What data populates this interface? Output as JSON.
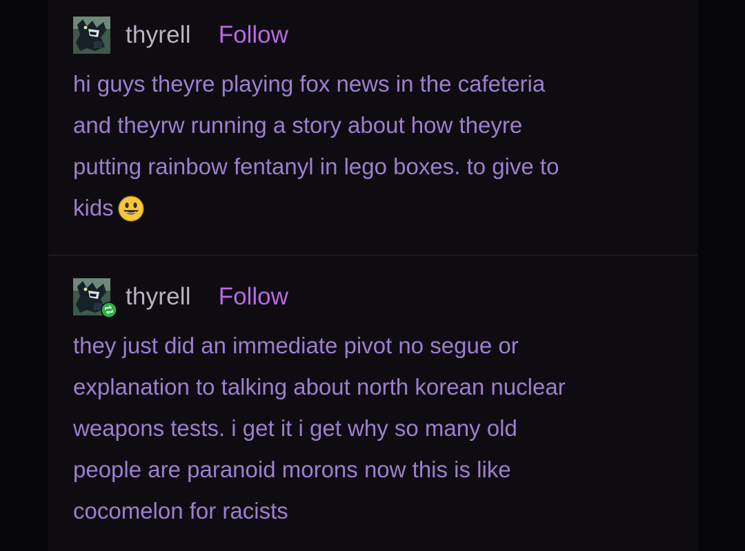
{
  "posts": [
    {
      "username": "thyrell",
      "follow_label": "Follow",
      "lines": [
        "hi guys theyre playing fox news in the cafeteria",
        "and theyrw running a story about how theyre",
        "putting rainbow fentanyl in lego boxes. to give to",
        "kids"
      ],
      "emoji": "smiley-face",
      "reblogged": false
    },
    {
      "username": "thyrell",
      "follow_label": "Follow",
      "lines": [
        "they just did an immediate pivot no segue or",
        "explanation to talking about north korean nuclear",
        "weapons tests. i get it i get why so many old",
        "people are paranoid morons now this is like",
        "cocomelon for racists"
      ],
      "reblogged": true
    }
  ],
  "colors": {
    "background": "#060508",
    "panel": "#0e0c11",
    "username": "#b9b3c3",
    "follow": "#b86ae6",
    "body_text": "#9d7fd0",
    "reblog_badge": "#2fb14a"
  },
  "icons": {
    "avatar": "monster-avatar",
    "reblog": "reblog-icon",
    "emoji": "smiley-emoji"
  }
}
